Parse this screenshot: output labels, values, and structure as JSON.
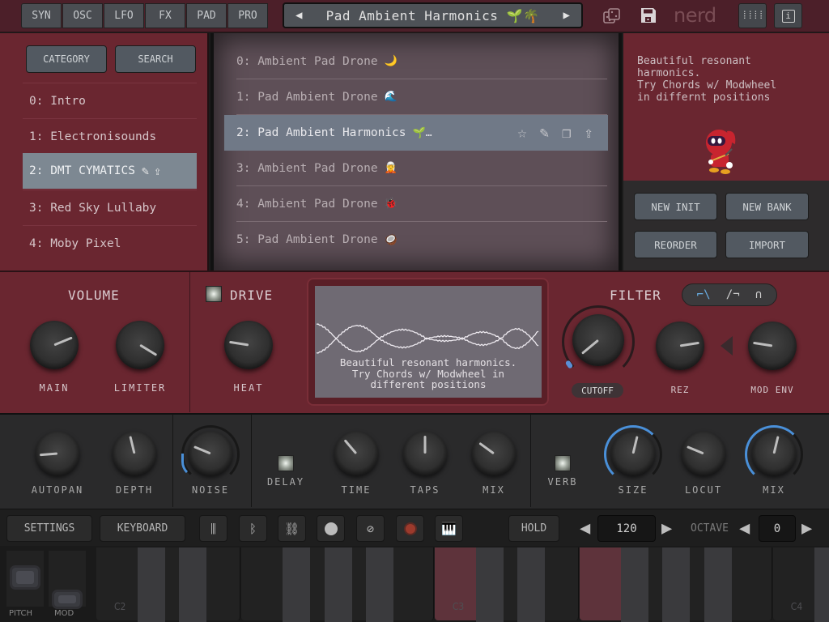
{
  "top_bar": {
    "tabs": [
      "SYN",
      "OSC",
      "LFO",
      "FX",
      "PAD",
      "PRO"
    ],
    "preset_name": "Pad Ambient Harmonics 🌱🌴",
    "prev_icon": "triangle-left-icon",
    "next_icon": "triangle-right-icon",
    "dice_icon": "dice-icon",
    "save_icon": "floppy-disk-icon",
    "brand": "nerd",
    "grid_icon": "grid-icon",
    "info_icon": "info-icon"
  },
  "bank_panel": {
    "category_label": "CATEGORY",
    "search_label": "SEARCH",
    "banks": [
      {
        "label": "0: Intro"
      },
      {
        "label": "1: Electronisounds"
      },
      {
        "label": "2: DMT CYMATICS",
        "selected": true
      },
      {
        "label": "3: Red Sky Lullaby"
      },
      {
        "label": "4: Moby Pixel"
      }
    ]
  },
  "preset_list": {
    "items": [
      {
        "label": "0: Ambient Pad Drone",
        "emoji": "🌙"
      },
      {
        "label": "1: Pad Ambient Drone",
        "emoji": "🌊"
      },
      {
        "label": "2: Pad Ambient Harmonics",
        "emoji": "🌱…",
        "selected": true
      },
      {
        "label": "3: Ambient Pad Drone",
        "emoji": "🧝"
      },
      {
        "label": "4: Ambient Pad Drone",
        "emoji": "🐞"
      },
      {
        "label": "5: Pad Ambient Drone",
        "emoji": "🥥"
      }
    ],
    "row_actions": [
      "star-icon",
      "edit-icon",
      "duplicate-icon",
      "share-icon"
    ]
  },
  "info_panel": {
    "description": "Beautiful resonant\nharmonics.\nTry Chords w/ Modwheel\nin differnt positions",
    "buttons": [
      "NEW INIT",
      "NEW BANK",
      "REORDER",
      "IMPORT"
    ]
  },
  "synth": {
    "volume": {
      "title": "VOLUME",
      "knobs": [
        {
          "label": "MAIN",
          "value": 0.75
        },
        {
          "label": "LIMITER",
          "value": 0.95
        }
      ]
    },
    "drive": {
      "title": "DRIVE",
      "enabled": true,
      "knobs": [
        {
          "label": "HEAT",
          "value": 0.2
        }
      ]
    },
    "scope_text": "Beautiful resonant harmonics.\nTry Chords w/ Modwheel in\ndifferent positions",
    "filter": {
      "title": "FILTER",
      "types": [
        "low-pass",
        "high-pass",
        "band-pass"
      ],
      "selected_type": "low-pass",
      "knobs": [
        {
          "label": "CUTOFF",
          "value": 0.02
        },
        {
          "label": "REZ",
          "value": 0.8
        },
        {
          "label": "MOD ENV",
          "value": 0.2
        }
      ]
    }
  },
  "fx": {
    "knobs_left": [
      {
        "label": "AUTOPAN",
        "value": 0.15
      },
      {
        "label": "DEPTH",
        "value": 0.45
      },
      {
        "label": "NOISE",
        "value": 0.25
      }
    ],
    "delay": {
      "label": "DELAY",
      "enabled": true,
      "knobs": [
        {
          "label": "TIME",
          "value": 0.35
        },
        {
          "label": "TAPS",
          "value": 0.5
        },
        {
          "label": "MIX",
          "value": 0.3
        }
      ]
    },
    "verb": {
      "label": "VERB",
      "enabled": true,
      "knobs": [
        {
          "label": "SIZE",
          "value": 0.55
        },
        {
          "label": "LOCUT",
          "value": 0.25
        },
        {
          "label": "MIX",
          "value": 0.55
        }
      ]
    }
  },
  "toolbar": {
    "settings_label": "SETTINGS",
    "keyboard_label": "KEYBOARD",
    "icons": [
      "sliders-icon",
      "bluetooth-icon",
      "link-icon",
      "midi-icon",
      "block-icon",
      "record-icon",
      "piano-icon"
    ],
    "hold_label": "HOLD",
    "tempo": "120",
    "octave_label": "OCTAVE",
    "octave": "0"
  },
  "keyboard": {
    "pitch_label": "PITCH",
    "mod_label": "MOD",
    "note_labels": [
      "C2",
      "C3",
      "C4"
    ],
    "pressed_keys": [
      "C3",
      "F3"
    ]
  }
}
